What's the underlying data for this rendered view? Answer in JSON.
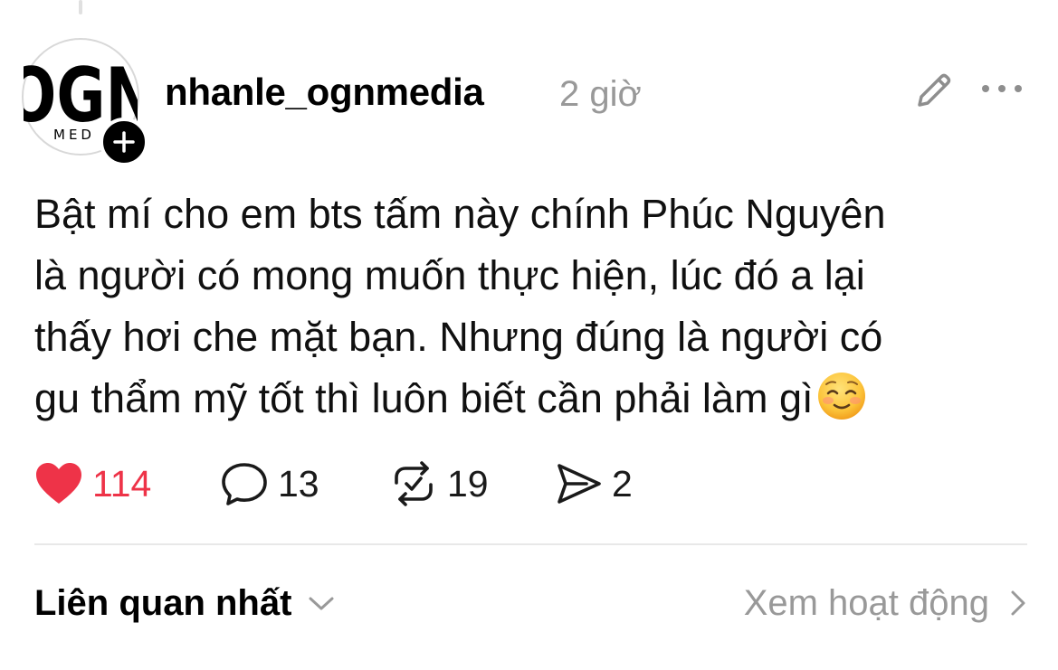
{
  "post": {
    "author": {
      "username": "nhanle_ognmedia",
      "avatar_logo_text": "OGN",
      "avatar_logo_subtext": "MED"
    },
    "timestamp": "2 giờ",
    "body_lines": [
      "Bật mí cho em bts tấm này chính Phúc Nguyên",
      "là người có mong muốn thực hiện, lúc đó a lại",
      "thấy hơi che mặt bạn. Nhưng đúng là người có",
      "gu thẩm mỹ tốt thì luôn biết cần phải làm gì"
    ],
    "emoji": "smiling-face-icon",
    "actions": {
      "likes": "114",
      "comments": "13",
      "reposts": "19",
      "shares": "2"
    },
    "liked": true
  },
  "footer": {
    "sort_label": "Liên quan nhất",
    "activity_link": "Xem hoạt động"
  },
  "colors": {
    "like_red": "#ee3348",
    "muted_gray": "#999999",
    "divider": "#e8e8e8"
  },
  "icons": [
    "edit-pencil-icon",
    "more-dots-icon",
    "heart-icon",
    "comment-bubble-icon",
    "repost-icon",
    "share-send-icon",
    "chevron-down-icon",
    "chevron-right-icon",
    "plus-icon"
  ]
}
